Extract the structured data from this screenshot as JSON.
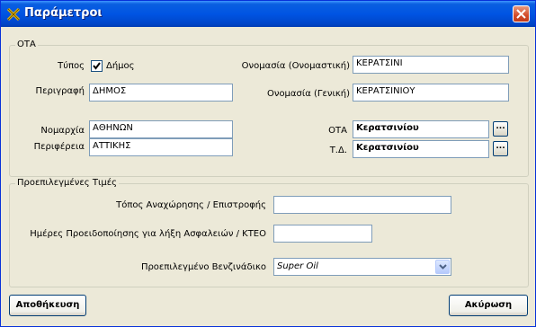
{
  "window": {
    "title": "Παράμετροι"
  },
  "ota_group": {
    "title": "ΟΤΑ",
    "type_label": "Τύπος",
    "type_checkbox_label": "Δήμος",
    "type_checked": true,
    "description_label": "Περιγραφή",
    "description_value": "ΔΗΜΟΣ",
    "prefecture_label": "Νομαρχία",
    "prefecture_value": "ΑΘΗΝΩΝ",
    "region_label": "Περιφέρεια",
    "region_value": "ΑΤΤΙΚΗΣ",
    "name_nominative_label": "Ονομασία (Ονομαστική)",
    "name_nominative_value": "ΚΕΡΑΤΣΙΝΙ",
    "name_genitive_label": "Ονομασία (Γενική)",
    "name_genitive_value": "ΚΕΡΑΤΣΙΝΙΟΥ",
    "ota_label": "ΟΤΑ",
    "ota_value": "Κερατσινίου",
    "td_label": "Τ.Δ.",
    "td_value": "Κερατσινίου",
    "browse_label": "..."
  },
  "defaults_group": {
    "title": "Προεπιλεγμένες Τιμές",
    "departure_label": "Τόπος  Αναχώρησης / Επιστροφής",
    "departure_value": "",
    "notice_days_label": "Ημέρες Προειδοποίησης για λήξη Ασφαλειών / ΚΤΕΟ",
    "notice_days_value": "",
    "gas_station_label": "Προεπιλεγμένο Βενζινάδικο",
    "gas_station_value": "Super Oil"
  },
  "buttons": {
    "save": "Αποθήκευση",
    "cancel": "Ακύρωση"
  }
}
